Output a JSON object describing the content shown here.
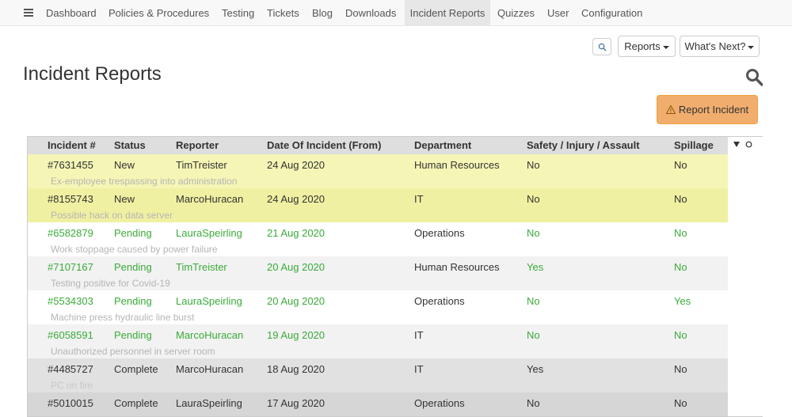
{
  "nav": {
    "items": [
      "Dashboard",
      "Policies & Procedures",
      "Testing",
      "Tickets",
      "Blog",
      "Downloads",
      "Incident Reports",
      "Quizzes",
      "User",
      "Configuration"
    ],
    "active": "Incident Reports"
  },
  "toolbar": {
    "reports_label": "Reports",
    "whats_next_label": "What's Next?"
  },
  "page": {
    "title": "Incident Reports",
    "report_button": "Report Incident"
  },
  "table": {
    "headers": [
      "Incident #",
      "Status",
      "Reporter",
      "Date Of Incident (From)",
      "Department",
      "Safety / Injury / Assault",
      "Spillage"
    ],
    "rows": [
      {
        "id": "#7631455",
        "status": "New",
        "reporter": "TimTreister",
        "date": "24 Aug 2020",
        "department": "Human Resources",
        "safety": "No",
        "spillage": "No",
        "description": "Ex-employee trespassing into administration",
        "state": "new"
      },
      {
        "id": "#8155743",
        "status": "New",
        "reporter": "MarcoHuracan",
        "date": "24 Aug 2020",
        "department": "IT",
        "safety": "No",
        "spillage": "No",
        "description": "Possible hack on data server",
        "state": "new"
      },
      {
        "id": "#6582879",
        "status": "Pending",
        "reporter": "LauraSpeirling",
        "date": "21 Aug 2020",
        "department": "Operations",
        "safety": "No",
        "spillage": "No",
        "description": "Work stoppage caused by power failure",
        "state": "pending"
      },
      {
        "id": "#7107167",
        "status": "Pending",
        "reporter": "TimTreister",
        "date": "20 Aug 2020",
        "department": "Human Resources",
        "safety": "Yes",
        "spillage": "No",
        "description": "Testing positive for Covid-19",
        "state": "pending"
      },
      {
        "id": "#5534303",
        "status": "Pending",
        "reporter": "LauraSpeirling",
        "date": "20 Aug 2020",
        "department": "Operations",
        "safety": "No",
        "spillage": "Yes",
        "description": "Machine press hydraulic line burst",
        "state": "pending"
      },
      {
        "id": "#6058591",
        "status": "Pending",
        "reporter": "MarcoHuracan",
        "date": "19 Aug 2020",
        "department": "IT",
        "safety": "No",
        "spillage": "No",
        "description": "Unauthorized personnel in server room",
        "state": "pending"
      },
      {
        "id": "#4485727",
        "status": "Complete",
        "reporter": "MarcoHuracan",
        "date": "18 Aug 2020",
        "department": "IT",
        "safety": "Yes",
        "spillage": "No",
        "description": "PC on fire",
        "state": "complete"
      },
      {
        "id": "#5010015",
        "status": "Complete",
        "reporter": "LauraSpeirling",
        "date": "17 Aug 2020",
        "department": "Operations",
        "safety": "No",
        "spillage": "No",
        "description": "",
        "state": "complete"
      }
    ]
  },
  "colors": {
    "new_row": "#f5f5b5",
    "pending_text": "#3aab3a",
    "complete_row": "#e1e1e1",
    "report_button": "#f0ad6e"
  },
  "icons": {
    "menu": "hamburger-icon",
    "search_small": "search-icon",
    "search_large": "search-icon",
    "warning": "warning-icon",
    "sort": "sort-down-icon",
    "settings": "circle-icon"
  }
}
